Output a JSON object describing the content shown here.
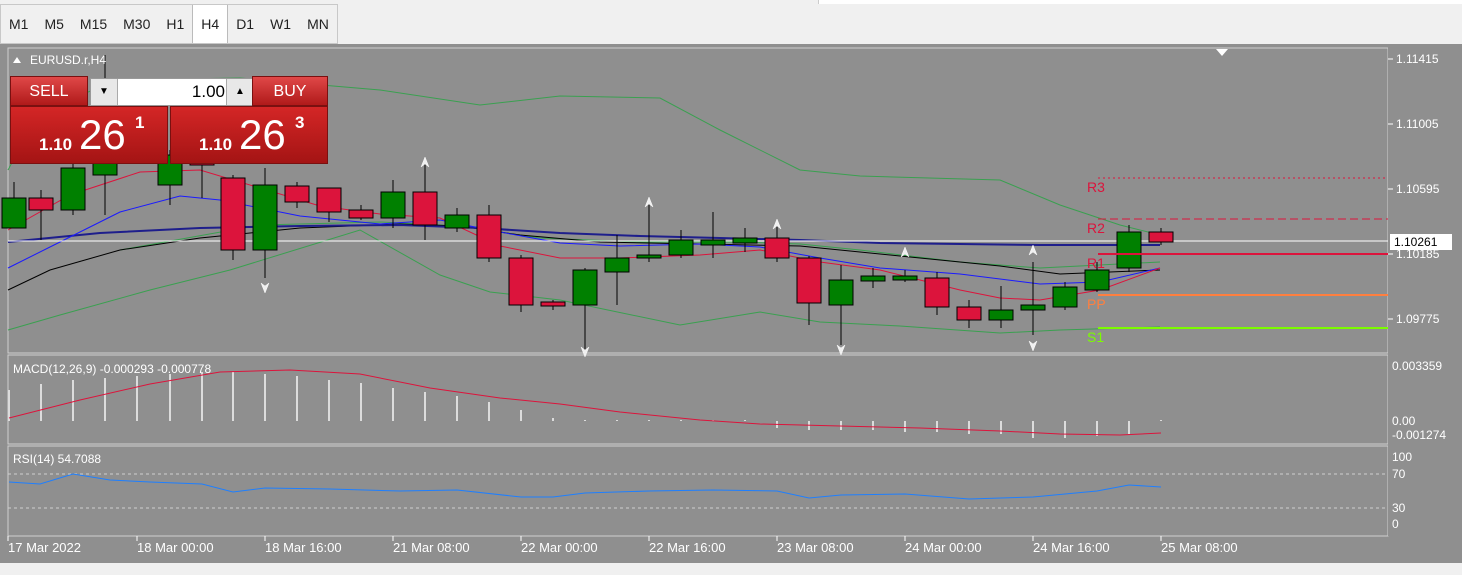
{
  "timeframes": [
    "M1",
    "M5",
    "M15",
    "M30",
    "H1",
    "H4",
    "D1",
    "W1",
    "MN"
  ],
  "active_timeframe": "H4",
  "chart": {
    "title": "EURUSD.r,H4",
    "current_price": "1.10261",
    "price_axis_labels": [
      "1.11415",
      "1.11005",
      "1.10595",
      "1.10185",
      "1.09775"
    ],
    "time_axis_labels": [
      "17 Mar 2022",
      "18 Mar 00:00",
      "18 Mar 16:00",
      "21 Mar 08:00",
      "22 Mar 00:00",
      "22 Mar 16:00",
      "23 Mar 08:00",
      "24 Mar 00:00",
      "24 Mar 16:00",
      "25 Mar 08:00"
    ],
    "pivot_labels": [
      "R3",
      "R2",
      "R1",
      "PP",
      "S1"
    ],
    "colors": {
      "bull": "#008000",
      "bear": "#dc143c",
      "bg": "#8f8f8f"
    }
  },
  "trade_panel": {
    "sell_label": "SELL",
    "buy_label": "BUY",
    "lot_value": "1.00",
    "sell_price_prefix": "1.10",
    "sell_price_big": "26",
    "sell_price_sup": "1",
    "buy_price_prefix": "1.10",
    "buy_price_big": "26",
    "buy_price_sup": "3"
  },
  "macd": {
    "label": "MACD(12,26,9) -0.000293 -0.000778",
    "axis_labels": [
      "0.003359",
      "0.00",
      "-0.001274"
    ]
  },
  "rsi": {
    "label": "RSI(14) 54.7088",
    "axis_labels": [
      "100",
      "70",
      "30",
      "0"
    ]
  }
}
